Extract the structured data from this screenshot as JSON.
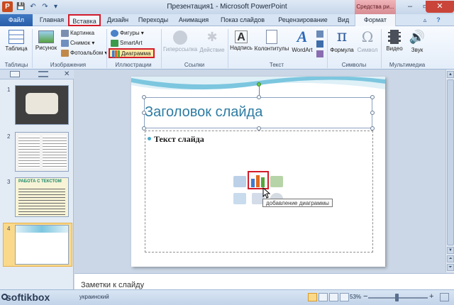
{
  "window": {
    "title": "Презентация1 - Microsoft PowerPoint",
    "app_logo": "P",
    "contextual_tools": "Средства ри..."
  },
  "tabs": [
    "Файл",
    "Главная",
    "Вставка",
    "Дизайн",
    "Переходы",
    "Анимация",
    "Показ слайдов",
    "Рецензирование",
    "Вид",
    "Формат"
  ],
  "ribbon": {
    "groups": {
      "tables": "Таблицы",
      "images": "Изображения",
      "illustrations": "Иллюстрации",
      "links": "Ссылки",
      "text": "Текст",
      "symbols": "Символы",
      "media": "Мультимедиа"
    },
    "buttons": {
      "table": "Таблица",
      "picture": "Рисунок",
      "clipart": "Картинка",
      "screenshot": "Снимок",
      "photo_album": "Фотоальбом",
      "shapes": "Фигуры",
      "smartart": "SmartArt",
      "chart": "Диаграмма",
      "hyperlink": "Гиперссылка",
      "action": "Действие",
      "textbox": "Надпись",
      "header_footer": "Колонтитулы",
      "wordart": "WordArt",
      "equation": "Формула",
      "symbol": "Символ",
      "video": "Видео",
      "audio": "Звук"
    }
  },
  "slides": {
    "numbers": [
      "1",
      "2",
      "3",
      "4"
    ],
    "selected": "4",
    "thumb3_title": "РАБОТА С ТЕКСТОМ"
  },
  "slide": {
    "title": "Заголовок слайда",
    "content": "Текст слайда",
    "tooltip": "добавление диаграммы"
  },
  "notes": {
    "placeholder": "Заметки к слайду"
  },
  "status": {
    "watermark": "softikbox",
    "language": "украинский",
    "zoom": "53%"
  },
  "colors": {
    "highlight": "#d31c2a",
    "title_text": "#2e7ca3",
    "file_tab": "#2a5ea8"
  }
}
